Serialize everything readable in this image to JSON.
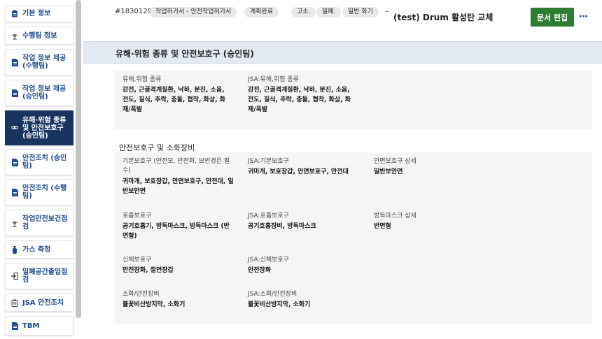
{
  "sidebar": {
    "items": [
      {
        "label": "기본 정보",
        "icon": "clipboard-icon"
      },
      {
        "label": "수행팀 정보",
        "icon": "worker-icon"
      },
      {
        "label": "작업 정보 제공 (수행팀)",
        "icon": "document-icon"
      },
      {
        "label": "작업 정보 제공 (승인팀)",
        "icon": "document-icon"
      },
      {
        "label": "유해·위험 종류 및 안전보호구 (승인팀)",
        "icon": "goggles-icon"
      },
      {
        "label": "안전조치 (승인팀)",
        "icon": "document-icon"
      },
      {
        "label": "안전조치 (수행팀)",
        "icon": "document-icon"
      },
      {
        "label": "작업안전보건점검",
        "icon": "worker-icon"
      },
      {
        "label": "가스 측정",
        "icon": "gas-icon"
      },
      {
        "label": "밀폐공간출입점검",
        "icon": "enter-icon"
      },
      {
        "label": "JSA 안전조치",
        "icon": "clipboard-list-icon"
      },
      {
        "label": "TBM",
        "icon": "document-icon"
      }
    ],
    "active_index": 4
  },
  "header": {
    "doc_id": "#1830129",
    "tags": [
      "작업허가서 - 안전작업허가서",
      "계획완료",
      "고소.",
      "밀폐.",
      "일반 화기"
    ],
    "dash": "–",
    "title": "(test) Drum 활성탄 교체",
    "edit_label": "문서 편집",
    "more_label": "···"
  },
  "section": {
    "title": "유해·위험 종류 및 안전보호구 (승인팀)",
    "hazard": {
      "label_1": "유해,위험 종류",
      "value_1": "감전, 근골격계질환, 낙하, 분진, 소음, 전도, 질식, 추락, 충돌, 협착, 화상, 화재/폭발",
      "label_2": "JSA:유해,위험 종류",
      "value_2": "감전, 근골격계질환, 낙하, 분진, 소음, 전도, 질식, 추락, 충돌, 협착, 화상, 화재/폭발"
    },
    "ppe_title": "안전보호구 및 소화장비",
    "ppe": {
      "basic_label": "기본보호구 (안전모, 안전화, 보안경은 필수)",
      "basic_value": "귀마개, 보호장갑, 안면보호구, 안전대, 일반보안면",
      "jsa_basic_label": "JSA:기본보호구",
      "jsa_basic_value": "귀마개, 보호장갑, 안면보호구, 안전대",
      "face_label": "안면보호구 상세",
      "face_value": "일반보안면",
      "resp_label": "호흡보호구",
      "resp_value": "공기호흡기, 방독마스크, 방독마스크 (반면형)",
      "jsa_resp_label": "JSA:호흡보호구",
      "jsa_resp_value": "공기호흡장비, 방독마스크",
      "gas_mask_label": "방독마스크 상세",
      "gas_mask_value": "반면형",
      "body_label": "신체보호구",
      "body_value": "안전장화, 절연장갑",
      "jsa_body_label": "JSA:신체보호구",
      "jsa_body_value": "안전장화",
      "fire_label": "소화/안전장비",
      "fire_value": "불꽃비산방지막, 소화기",
      "jsa_fire_label": "JSA:소화/안전장비",
      "jsa_fire_value": "불꽃비산방지막, 소화기"
    }
  },
  "colors": {
    "nav_text": "#1e4b8f",
    "nav_active_bg": "#18355f",
    "edit_button_bg": "#2e7d32",
    "section_header_bg": "#e4eaf3",
    "card_bg": "#f5f5f5"
  }
}
